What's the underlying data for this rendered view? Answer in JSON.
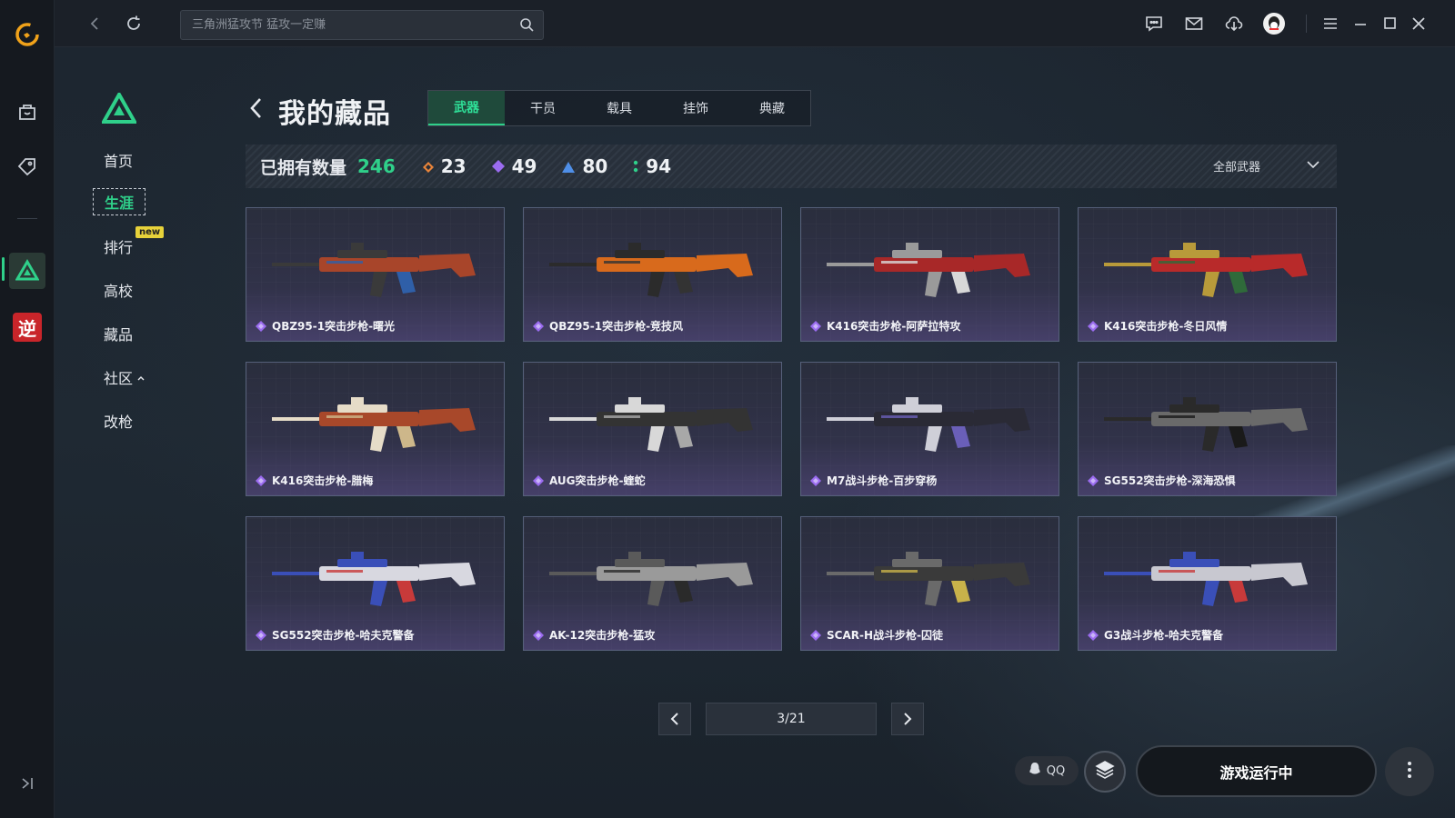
{
  "topbar": {
    "search_placeholder": "三角洲猛攻节 猛攻一定赚"
  },
  "icons": {
    "rail": [
      "app-logo-icon",
      "bag-icon",
      "tag-icon",
      "delta-game-icon",
      "ni-game-icon",
      "collapse-icon"
    ],
    "topbar": [
      "back-icon",
      "refresh-icon",
      "search-icon",
      "chat-icon",
      "mail-icon",
      "download-icon",
      "qq-avatar-icon",
      "menu-icon",
      "minimize-icon",
      "maximize-icon",
      "close-icon"
    ]
  },
  "sidenav": {
    "items": [
      {
        "label": "首页"
      },
      {
        "label": "生涯"
      },
      {
        "label": "排行"
      },
      {
        "label": "高校"
      },
      {
        "label": "藏品"
      },
      {
        "label": "社区"
      },
      {
        "label": "改枪"
      }
    ],
    "active": "生涯",
    "new_badge": "new"
  },
  "header": {
    "title": "我的藏品",
    "tabs": [
      "武器",
      "干员",
      "载具",
      "挂饰",
      "典藏"
    ],
    "active_tab": "武器"
  },
  "stats": {
    "owned_label": "已拥有数量",
    "owned_total": "246",
    "tiers": [
      {
        "value": "23",
        "color": "#e8843a"
      },
      {
        "value": "49",
        "color": "#9b6cf0"
      },
      {
        "value": "80",
        "color": "#4f8fe8"
      },
      {
        "value": "94",
        "color": "#2fd08a"
      }
    ],
    "filter_label": "全部武器"
  },
  "items": [
    {
      "name": "QBZ95-1突击步枪-曙光",
      "palette": [
        "#3a3a3a",
        "#a8452a",
        "#2f5fa8"
      ]
    },
    {
      "name": "QBZ95-1突击步枪-竞技风",
      "palette": [
        "#2b2b2b",
        "#d86a1c",
        "#333"
      ]
    },
    {
      "name": "K416突击步枪-阿萨拉特攻",
      "palette": [
        "#9a9a9a",
        "#a82828",
        "#d8d8d8"
      ]
    },
    {
      "name": "K416突击步枪-冬日风情",
      "palette": [
        "#b89a3a",
        "#b82a2a",
        "#2f6a3a"
      ]
    },
    {
      "name": "K416突击步枪-腊梅",
      "palette": [
        "#e6dcc8",
        "#a8482a",
        "#cdb78a"
      ]
    },
    {
      "name": "AUG突击步枪-蝰蛇",
      "palette": [
        "#d8d8d8",
        "#333",
        "#a8a8a8"
      ]
    },
    {
      "name": "M7战斗步枪-百步穿杨",
      "palette": [
        "#cfcfd8",
        "#2a2a35",
        "#6a5fb8"
      ]
    },
    {
      "name": "SG552突击步枪-深海恐惧",
      "palette": [
        "#2a2a2a",
        "#6a6a6a",
        "#1a1a1a"
      ]
    },
    {
      "name": "SG552突击步枪-哈夫克警备",
      "palette": [
        "#3a4fb8",
        "#d8d8e0",
        "#c83a3a"
      ]
    },
    {
      "name": "AK-12突击步枪-猛攻",
      "palette": [
        "#5a5a5a",
        "#9a9a9a",
        "#2a2a2a"
      ]
    },
    {
      "name": "SCAR-H战斗步枪-囚徒",
      "palette": [
        "#6a6a6a",
        "#3a3a3a",
        "#c8b24a"
      ]
    },
    {
      "name": "G3战斗步枪-哈夫克警备",
      "palette": [
        "#3a4fb8",
        "#c8c8d0",
        "#c83a3a"
      ]
    }
  ],
  "rarity_color": "#9b6cf0",
  "pagination": {
    "page_label": "3/21"
  },
  "bottom": {
    "qq_label": "QQ",
    "run_label": "游戏运行中"
  },
  "colors": {
    "accent": "#2fd08a",
    "tab_active_bg": "#1f4a3b"
  }
}
